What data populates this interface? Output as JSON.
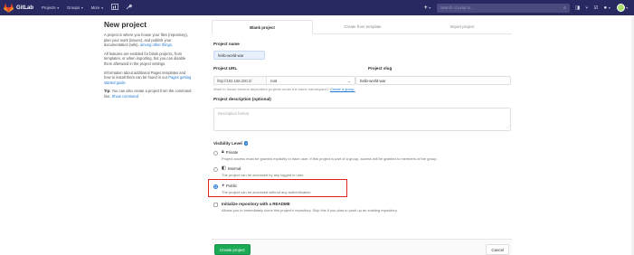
{
  "navbar": {
    "brand": "GitLab",
    "menu": [
      "Projects",
      "Groups",
      "More"
    ],
    "search_placeholder": "Search or jump to…"
  },
  "left": {
    "title": "New project",
    "para1_text": "A project is where you house your files (repository), plan your work (issues), and publish your documentation (wiki),",
    "para1_link": "among other things.",
    "para2": "All features are enabled for blank projects, from templates, or when importing, but you can disable them afterward in the project settings.",
    "para3_text": "Information about additional Pages templates and how to install them can be found in our",
    "para3_link": "Pages getting started guide.",
    "tip_label": "Tip:",
    "tip_text": "You can also create a project from the command line.",
    "tip_link": "Show command"
  },
  "tabs": [
    "Blank project",
    "Create from template",
    "Import project"
  ],
  "form": {
    "project_name_label": "Project name",
    "project_name_value": "hello-world-war",
    "project_url_label": "Project URL",
    "project_url_prefix": "http://192.168.200.2/",
    "namespace_value": "root",
    "project_slug_label": "Project slug",
    "project_slug_value": "hello-world-war",
    "namespace_help": "Want to house several dependent projects under the same namespace?",
    "namespace_help_link": "Create a group.",
    "description_label": "Project description (optional)",
    "description_placeholder": "Description format",
    "visibility_label": "Visibility Level",
    "visibility": [
      {
        "title": "Private",
        "desc": "Project access must be granted explicitly to each user. If this project is part of a group, access will be granted to members of the group."
      },
      {
        "title": "Internal",
        "desc": "The project can be accessed by any logged in user."
      },
      {
        "title": "Public",
        "desc": "The project can be accessed without any authentication."
      }
    ],
    "visibility_selected": "Public",
    "readme_label": "Initialize repository with a README",
    "readme_desc": "Allows you to immediately clone this project’s repository. Skip this if you plan to push up an existing repository.",
    "create_button": "Create project",
    "cancel_button": "Cancel"
  },
  "colors": {
    "navbar": "#292961",
    "primary_green": "#1aaa55",
    "link_blue": "#1f78d1",
    "highlight_red": "#e42222"
  },
  "icons": [
    "gitlab-logo-icon",
    "chevron-down-icon",
    "activity-icon",
    "wrench-icon",
    "plus-icon",
    "search-icon",
    "issues-icon",
    "merge-request-icon",
    "todo-icon",
    "help-icon",
    "avatar",
    "lock-icon",
    "shield-icon",
    "globe-icon",
    "question-icon"
  ]
}
